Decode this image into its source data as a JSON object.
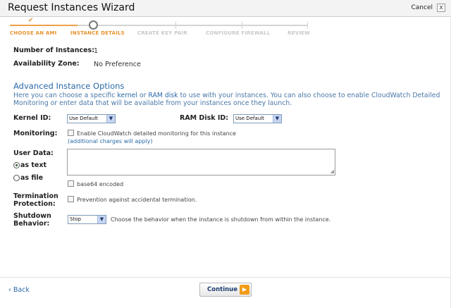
{
  "window": {
    "title": "Request Instances Wizard",
    "cancel_label": "Cancel",
    "close_glyph": "x"
  },
  "steps": {
    "tick_glyph": "✔",
    "items": [
      {
        "label": "CHOOSE AN AMI",
        "state": "done"
      },
      {
        "label": "INSTANCE DETAILS",
        "state": "active"
      },
      {
        "label": "CREATE KEY PAIR",
        "state": "future"
      },
      {
        "label": "CONFIGURE FIREWALL",
        "state": "future"
      },
      {
        "label": "REVIEW",
        "state": "future"
      }
    ]
  },
  "summary": {
    "instances_label": "Number of Instances:",
    "instances_value": "1",
    "zone_label": "Availability Zone:",
    "zone_value": "No Preference"
  },
  "advanced": {
    "title": "Advanced Instance Options",
    "desc_1": "Here you can choose a specific ",
    "desc_kernel": "kernel",
    "desc_2": " or ",
    "desc_ramdisk": "RAM disk",
    "desc_3": " to use with your instances. You can also choose to enable CloudWatch Detailed Monitoring or enter data that will be available from your instances once they launch.",
    "kernel_label": "Kernel ID:",
    "kernel_value": "Use Default",
    "ramdisk_label": "RAM Disk ID:",
    "ramdisk_value": "Use Default",
    "monitoring_label": "Monitoring:",
    "monitoring_text": "Enable CloudWatch detailed monitoring for this instance",
    "monitoring_note": "(additional charges will apply)",
    "userdata_label": "User Data:",
    "as_text": "as text",
    "as_file": "as file",
    "userdata_value": "",
    "base64_label": "base64 encoded",
    "termination_label_1": "Termination",
    "termination_label_2": "Protection:",
    "termination_text": "Prevention against accidental termination.",
    "shutdown_label_1": "Shutdown",
    "shutdown_label_2": "Behavior:",
    "shutdown_value": "Stop",
    "shutdown_text": "Choose the behavior when the instance is shutdown from within the instance."
  },
  "footer": {
    "back_label": "‹ Back",
    "continue_label": "Continue",
    "continue_glyph": "▶"
  },
  "colors": {
    "accent": "#e8922e",
    "link": "#2a6aa8",
    "button_icon": "#f39c18"
  }
}
